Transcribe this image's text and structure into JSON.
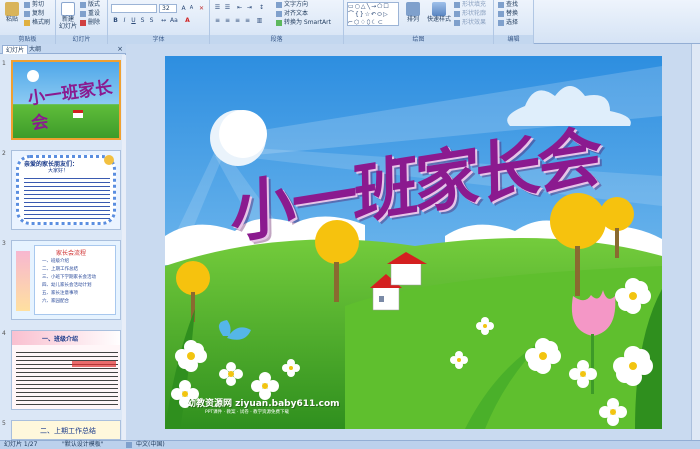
{
  "ribbon": {
    "clipboard": {
      "label": "剪贴板",
      "paste": "粘贴",
      "cut": "剪切",
      "copy": "复制",
      "format_painter": "格式刷"
    },
    "slides": {
      "label": "幻灯片",
      "new_slide": "新建\n幻灯片",
      "layout": "版式",
      "reset": "重设",
      "delete": "删除"
    },
    "font": {
      "label": "字体",
      "font_size": "32"
    },
    "paragraph": {
      "label": "段落",
      "text_direction": "文字方向",
      "align_text": "对齐文本",
      "convert_smartart": "转换为 SmartArt"
    },
    "drawing": {
      "label": "绘图",
      "arrange": "排列",
      "quick_styles": "快速样式",
      "shape_fill": "形状填充",
      "shape_outline": "形状轮廓",
      "shape_effects": "形状效果"
    },
    "editing": {
      "label": "编辑",
      "find": "查找",
      "replace": "替换",
      "select": "选择"
    }
  },
  "pane": {
    "tab_slides": "幻灯片",
    "tab_outline": "大纲",
    "close": "×",
    "thumbs": [
      {
        "num": "1",
        "title": "小一班家长会"
      },
      {
        "num": "2",
        "heading": "亲爱的家长朋友们：",
        "sub": "大家好！"
      },
      {
        "num": "3",
        "heading": "家长会流程",
        "items": [
          "一、班级介绍",
          "二、上期工作总结",
          "三、小班下学期家长会活动",
          "四、幼儿家长会活动计划",
          "五、家长注意事项",
          "六、家园配合"
        ]
      },
      {
        "num": "4",
        "heading": "一、班级介绍"
      },
      {
        "num": "5",
        "heading": "二、上期工作总结"
      }
    ]
  },
  "slide": {
    "title": "小一班家长会",
    "watermark": "幼教资源网 ziyuan.baby611.com",
    "watermark_sub": "PPT课件 · 教案 · 试卷 · 教学资源免费下载"
  },
  "status": {
    "slide_count": "幻灯片 1/27",
    "theme": "\"默认设计模板\"",
    "language": "中文(中国)"
  },
  "colors": {
    "title": "#8b1a8f",
    "sky": "#4aa3e6",
    "grass": "#4fb832",
    "accent_orange": "#f0a030"
  }
}
